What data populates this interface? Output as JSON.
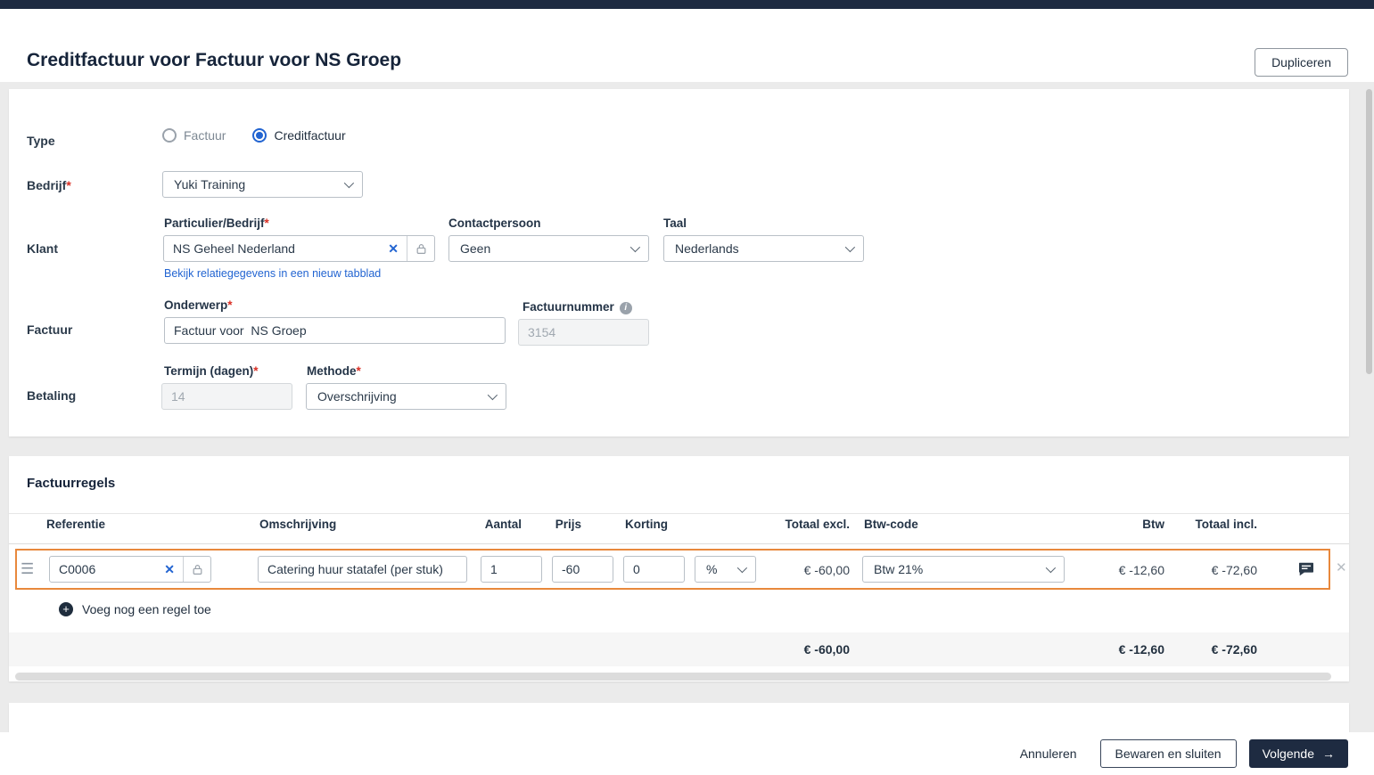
{
  "colors": {
    "topbar": "#1e2b41",
    "accent_blue": "#2264d1",
    "link_blue": "#2264d1",
    "highlight_orange": "#e8883c"
  },
  "ui": {
    "required_mark": "*"
  },
  "icons": {
    "clear": "✕",
    "remove": "✕",
    "plus": "+",
    "drag": "☰",
    "info": "i",
    "arrow_right": "→"
  },
  "header": {
    "title": "Creditfactuur voor Factuur voor NS Groep",
    "duplicate_button": "Dupliceren"
  },
  "form": {
    "type": {
      "label": "Type",
      "options": [
        {
          "label": "Factuur",
          "selected": false
        },
        {
          "label": "Creditfactuur",
          "selected": true
        }
      ]
    },
    "bedrijf": {
      "label": "Bedrijf",
      "value": "Yuki Training"
    },
    "klant": {
      "label": "Klant",
      "particulier_label": "Particulier/Bedrijf",
      "particulier_value": "NS Geheel Nederland",
      "link": "Bekijk relatiegegevens in een nieuw tabblad",
      "contactpersoon_label": "Contactpersoon",
      "contactpersoon_value": "Geen",
      "taal_label": "Taal",
      "taal_value": "Nederlands"
    },
    "factuur": {
      "label": "Factuur",
      "onderwerp_label": "Onderwerp",
      "onderwerp_value": "Factuur voor  NS Groep",
      "factuurnummer_label": "Factuurnummer",
      "factuurnummer_value": "3154"
    },
    "betaling": {
      "label": "Betaling",
      "termijn_label": "Termijn (dagen)",
      "termijn_value": "14",
      "methode_label": "Methode",
      "methode_value": "Overschrijving"
    }
  },
  "invoice_lines": {
    "title": "Factuurregels",
    "columns": {
      "referentie": "Referentie",
      "omschrijving": "Omschrijving",
      "aantal": "Aantal",
      "prijs": "Prijs",
      "korting": "Korting",
      "totaal_excl": "Totaal excl.",
      "btw_code": "Btw-code",
      "btw": "Btw",
      "totaal_incl": "Totaal incl."
    },
    "rows": [
      {
        "referentie": "C0006",
        "omschrijving": "Catering huur statafel (per stuk)",
        "aantal": "1",
        "prijs": "-60",
        "korting": "0",
        "korting_unit": "%",
        "totaal_excl": "€ -60,00",
        "btw_code": "Btw 21%",
        "btw": "€ -12,60",
        "totaal_incl": "€ -72,60"
      }
    ],
    "add_row_label": "Voeg nog een regel toe",
    "totals": {
      "totaal_excl": "€ -60,00",
      "btw": "€ -12,60",
      "totaal_incl": "€ -72,60"
    }
  },
  "footer": {
    "cancel": "Annuleren",
    "save_close": "Bewaren en sluiten",
    "next": "Volgende"
  }
}
